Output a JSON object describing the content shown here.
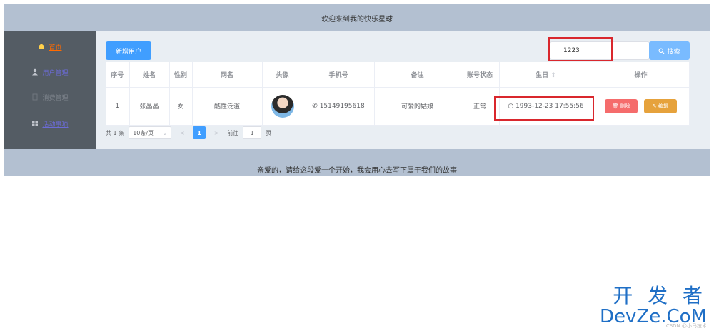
{
  "header": {
    "title": "欢迎来到我的快乐星球"
  },
  "sidebar": {
    "items": [
      {
        "label": "首页",
        "icon": "home-icon"
      },
      {
        "label": "用户管理",
        "icon": "user-icon"
      },
      {
        "label": "消费管理",
        "icon": "document-icon"
      },
      {
        "label": "活动事项",
        "icon": "grid-icon"
      }
    ]
  },
  "toolbar": {
    "add_label": "新增用户",
    "search_value": "1223",
    "search_label": "搜索"
  },
  "table": {
    "columns": [
      "序号",
      "姓名",
      "性别",
      "网名",
      "头像",
      "手机号",
      "备注",
      "账号状态",
      "生日",
      "操作"
    ],
    "rows": [
      {
        "index": "1",
        "name": "张晶晶",
        "gender": "女",
        "nickname": "酷性泛滥",
        "phone": "15149195618",
        "note": "可爱的姑娘",
        "status": "正常",
        "birthday": "1993-12-23 17:55:56",
        "delete_label": "删除",
        "edit_label": "编辑"
      }
    ]
  },
  "pagination": {
    "total": "共 1 条",
    "page_size": "10条/页",
    "current_page": "1",
    "goto_label": "前往",
    "goto_value": "1",
    "page_unit": "页"
  },
  "footer": {
    "text": "亲爱的，请给这段爱一个开始，我会用心去写下属于我们的故事"
  },
  "watermark": {
    "top": "开 发 者",
    "bottom": "DevZe.CoM",
    "csdn": "CSDN @小马技术"
  },
  "colors": {
    "primary": "#409eff",
    "danger": "#f56c6c",
    "warning": "#e6a23c",
    "success": "#67c23a",
    "highlight": "#d9272d"
  }
}
